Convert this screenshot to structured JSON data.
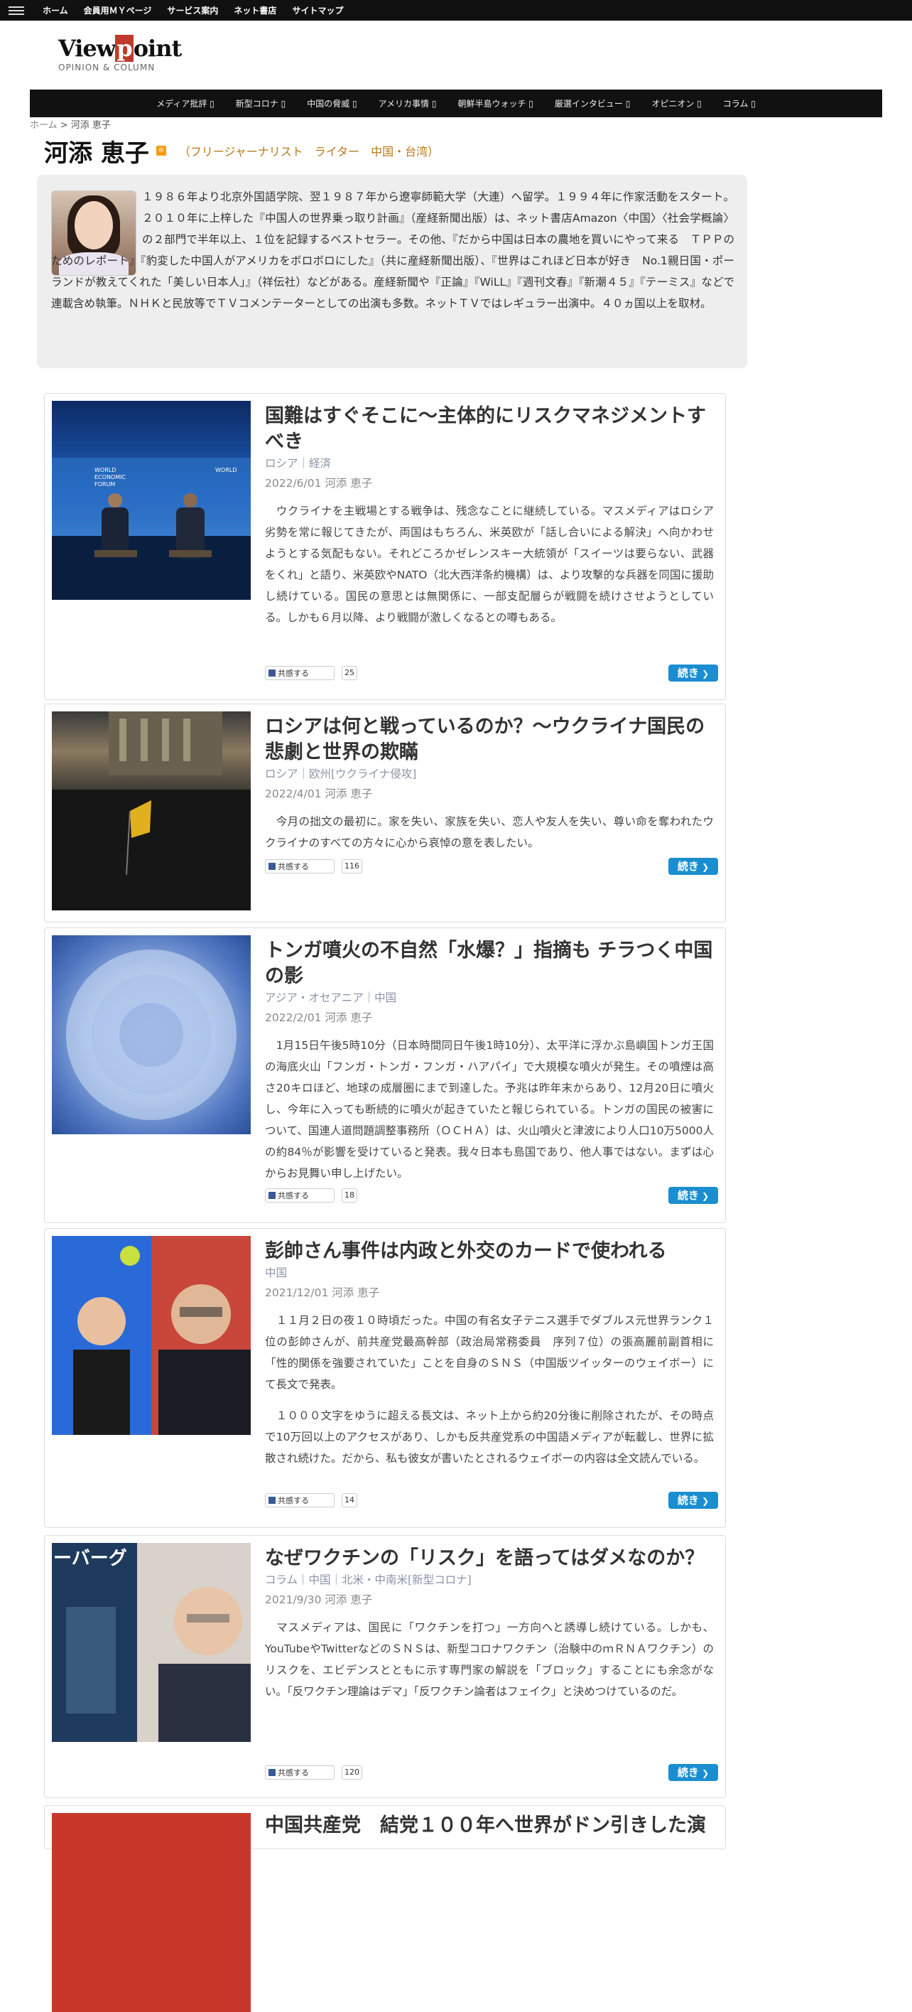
{
  "topnav": [
    "ホーム",
    "会員用ＭＹページ",
    "サービス案内",
    "ネット書店",
    "サイトマップ"
  ],
  "logo": {
    "main": "Viewpoint",
    "sub": "OPINION & COLUMN"
  },
  "mainnav": [
    "メディア批評 ▯",
    "新型コロナ ▯",
    "中国の脅威 ▯",
    "アメリカ事情 ▯",
    "朝鮮半島ウォッチ ▯",
    "厳選インタビュー ▯",
    "オピニオン ▯",
    "コラム ▯"
  ],
  "breadcrumb": {
    "home": "ホーム",
    "sep": " > ",
    "current": "河添 恵子"
  },
  "author": {
    "name": "河添 恵子",
    "rss": "RSS",
    "tagline": "（フリージャーナリスト　ライター　中国・台湾）",
    "bio": "１９８６年より北京外国語学院、翌１９８７年から遼寧師範大学（大連）へ留学。１９９４年に作家活動をスタート。２０１０年に上梓した『中国人の世界乗っ取り計画』（産経新聞出版）は、ネット書店Amazon〈中国〉〈社会学概論〉の２部門で半年以上、１位を記録するベストセラー。その他、『だから中国は日本の農地を買いにやって来る　ＴＰＰのためのレポート』『豹変した中国人がアメリカをボロボロにした』（共に産経新聞出版）、『世界はこれほど日本が好き　No.1親日国・ポーランドが教えてくれた「美しい日本人」』（祥伝社）などがある。産経新聞や『正論』『WiLL』『週刊文春』『新潮４５』『テーミス』などで連載含め執筆。ＮＨＫと民放等でＴＶコメンテーターとしての出演も多数。ネットＴＶではレギュラー出演中。４０ヵ国以上を取材。"
  },
  "articles": [
    {
      "title": "国難はすぐそこに～主体的にリスクマネジメントすべき",
      "cats": "ロシア｜経済",
      "date": "2022/6/01 河添 恵子",
      "excerpt": "　ウクライナを主戦場とする戦争は、残念なことに継続している。マスメディアはロシア劣勢を常に報じてきたが、両国はもちろん、米英欧が「話し合いによる解決」へ向かわせようとする気配もない。それどころかゼレンスキー大統領が「スイーツは要らない、武器をくれ」と語り、米英欧やNATO（北大西洋条約機構）は、より攻撃的な兵器を同国に援助し続けている。国民の意思とは無関係に、一部支配層らが戦闘を続けさせようとしている。しかも６月以降、より戦闘が激しくなるとの噂もある。",
      "share": "共感する",
      "count": "25",
      "more": "続き",
      "thumb_text": "WORLD ECONOMIC FORUM"
    },
    {
      "title": "ロシアは何と戦っているのか？～ウクライナ国民の悲劇と世界の欺瞞",
      "cats": "ロシア｜欧州[ウクライナ侵攻]",
      "date": "2022/4/01 河添 恵子",
      "excerpt": "　今月の拙文の最初に。家を失い、家族を失い、恋人や友人を失い、尊い命を奪われたウクライナのすべての方々に心から哀悼の意を表したい。",
      "share": "共感する",
      "count": "116",
      "more": "続き"
    },
    {
      "title": "トンガ噴火の不自然「水爆？」指摘も チラつく中国の影",
      "cats": "アジア・オセアニア｜中国",
      "date": "2022/2/01 河添 恵子",
      "excerpt": "　1月15日午後5時10分（日本時間同日午後1時10分）、太平洋に浮かぶ島嶼国トンガ王国の海底火山「フンガ・トンガ・フンガ・ハアパイ」で大規模な噴火が発生。その噴煙は高さ20キロほど、地球の成層圏にまで到達した。予兆は昨年末からあり、12月20日に噴火し、今年に入っても断続的に噴火が起きていたと報じられている。トンガの国民の被害について、国連人道問題調整事務所（ＯＣＨＡ）は、火山噴火と津波により人口10万5000人の約84％が影響を受けていると発表。我々日本も島国であり、他人事ではない。まずは心からお見舞い申し上げたい。",
      "share": "共感する",
      "count": "18",
      "more": "続き"
    },
    {
      "title": "彭帥さん事件は内政と外交のカードで使われる",
      "cats": "中国",
      "date": "2021/12/01 河添 恵子",
      "excerpt": "　１１月２日の夜１０時頃だった。中国の有名女子テニス選手でダブルス元世界ランク１位の彭帥さんが、前共産党最高幹部（政治局常務委員　序列７位）の張高麗前副首相に「性的関係を強要されていた」ことを自身のＳＮＳ（中国版ツイッターのウェイボー）にて長文で発表。",
      "excerpt2": "　１０００文字をゆうに超える長文は、ネット上から約20分後に削除されたが、その時点で10万回以上のアクセスがあり、しかも反共産党系の中国語メディアが転載し、世界に拡散され続けた。だから、私も彼女が書いたとされるウェイボーの内容は全文読んでいる。",
      "share": "共感する",
      "count": "14",
      "more": "続き"
    },
    {
      "title": "なぜワクチンの「リスク」を語ってはダメなのか？",
      "cats": "コラム｜中国｜北米・中南米[新型コロナ]",
      "date": "2021/9/30 河添 恵子",
      "excerpt": "　マスメディアは、国民に「ワクチンを打つ」一方向へと誘導し続けている。しかも、YouTubeやTwitterなどのＳＮＳは、新型コロナワクチン（治験中のｍＲＮＡワクチン）のリスクを、エビデンスとともに示す専門家の解説を「ブロック」することにも余念がない。「反ワクチン理論はデマ」「反ワクチン論者はフェイク」と決めつけているのだ。",
      "share": "共感する",
      "count": "120",
      "more": "続き",
      "thumb_text": "ーバーグ"
    },
    {
      "title": "中国共産党　結党１００年へ世界がドン引きした演",
      "cats": "",
      "date": "",
      "excerpt": ""
    }
  ]
}
